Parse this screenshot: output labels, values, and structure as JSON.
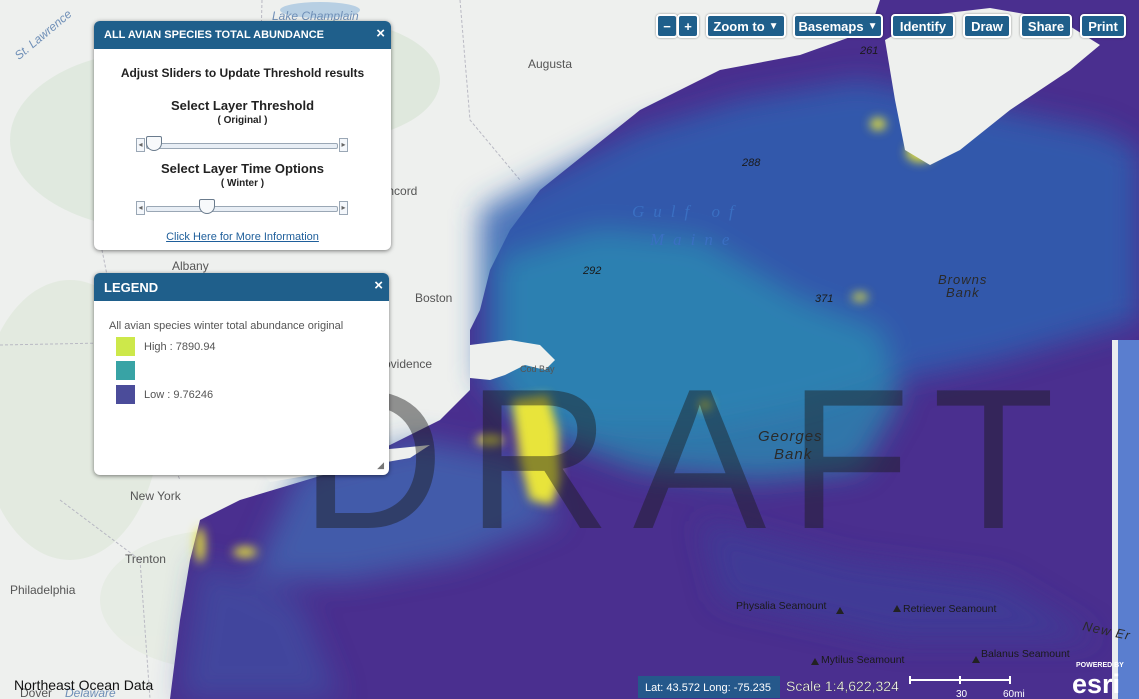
{
  "map": {
    "watermark": "DRAFT",
    "places": {
      "st_lawrence": "St. Lawrence",
      "lake_champlain": "Lake Champlain",
      "augusta": "Augusta",
      "concord": "Concord",
      "albany": "Albany",
      "boston": "Boston",
      "providence": "Providence",
      "cod_bay": "Cod Bay",
      "new_york": "New York",
      "trenton": "Trenton",
      "philadelphia": "Philadelphia",
      "dover": "Dover",
      "delaware": "Delaware"
    },
    "marine": {
      "gulf_of": "Gulf of",
      "maine": "Maine",
      "georges": "Georges",
      "bank": "Bank",
      "browns": "Browns",
      "browns_bank": "Bank",
      "new_england": "New Er"
    },
    "depths": [
      "261",
      "288",
      "292",
      "371"
    ],
    "seamounts": {
      "physalia": "Physalia Seamount",
      "retriever": "Retriever Seamount",
      "mytilus": "Mytilus Seamount",
      "balanus": "Balanus Seamount"
    },
    "footer_left": "Northeast Ocean Data",
    "coords": "Lat: 43.572 Long: -75.235",
    "scale": "Scale 1:4,622,324",
    "scale_ticks": [
      "30",
      "60mi"
    ],
    "esri_powered": "POWERED BY",
    "esri_logo": "esri",
    "colors": {
      "ocean_high": "#e8e43a",
      "ocean_mid": "#2a8fb3",
      "ocean_low": "#4a2f8f",
      "land": "#eef0ee"
    }
  },
  "toolbar": {
    "zoom_out": "−",
    "zoom_in": "+",
    "zoom_to": "Zoom to",
    "basemaps": "Basemaps",
    "identify": "Identify",
    "draw": "Draw",
    "share": "Share",
    "print": "Print",
    "caret_icon": "caret-down-icon"
  },
  "threshold_panel": {
    "title": "ALL AVIAN SPECIES TOTAL ABUNDANCE",
    "close": "×",
    "instruction": "Adjust Sliders to Update Threshold results",
    "threshold_label": "Select Layer Threshold",
    "threshold_value": "( Original )",
    "time_label": "Select Layer Time Options",
    "time_value": "( Winter )",
    "threshold_slider_position": 0.0,
    "time_slider_position": 0.3,
    "more_info_link": "Click Here for More Information"
  },
  "legend_panel": {
    "title": "LEGEND",
    "close": "×",
    "layer_name": "All avian species winter total abundance original",
    "high_label": "High : 7890.94",
    "low_label": "Low : 9.76246",
    "colors": {
      "high": "#cde84a",
      "mid": "#38a3a5",
      "low": "#4b4c9a"
    }
  }
}
